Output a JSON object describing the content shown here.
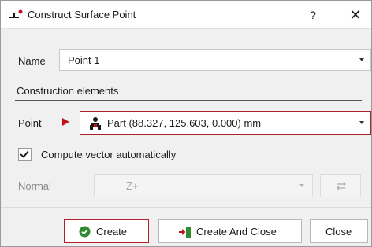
{
  "dialog": {
    "title": "Construct Surface Point",
    "help_label": "?",
    "close_label": "✕"
  },
  "name_row": {
    "label": "Name",
    "value": "Point 1"
  },
  "construction": {
    "section_title": "Construction elements",
    "point_label": "Point",
    "point_value": "Part (88.327, 125.603, 0.000) mm",
    "compute_label": "Compute vector automatically",
    "compute_checked": true,
    "normal_label": "Normal",
    "normal_value": "Z+"
  },
  "buttons": {
    "create": "Create",
    "create_and_close": "Create And Close",
    "close": "Close"
  },
  "colors": {
    "accent_red": "#c1121c",
    "create_green": "#2e8b2e"
  }
}
